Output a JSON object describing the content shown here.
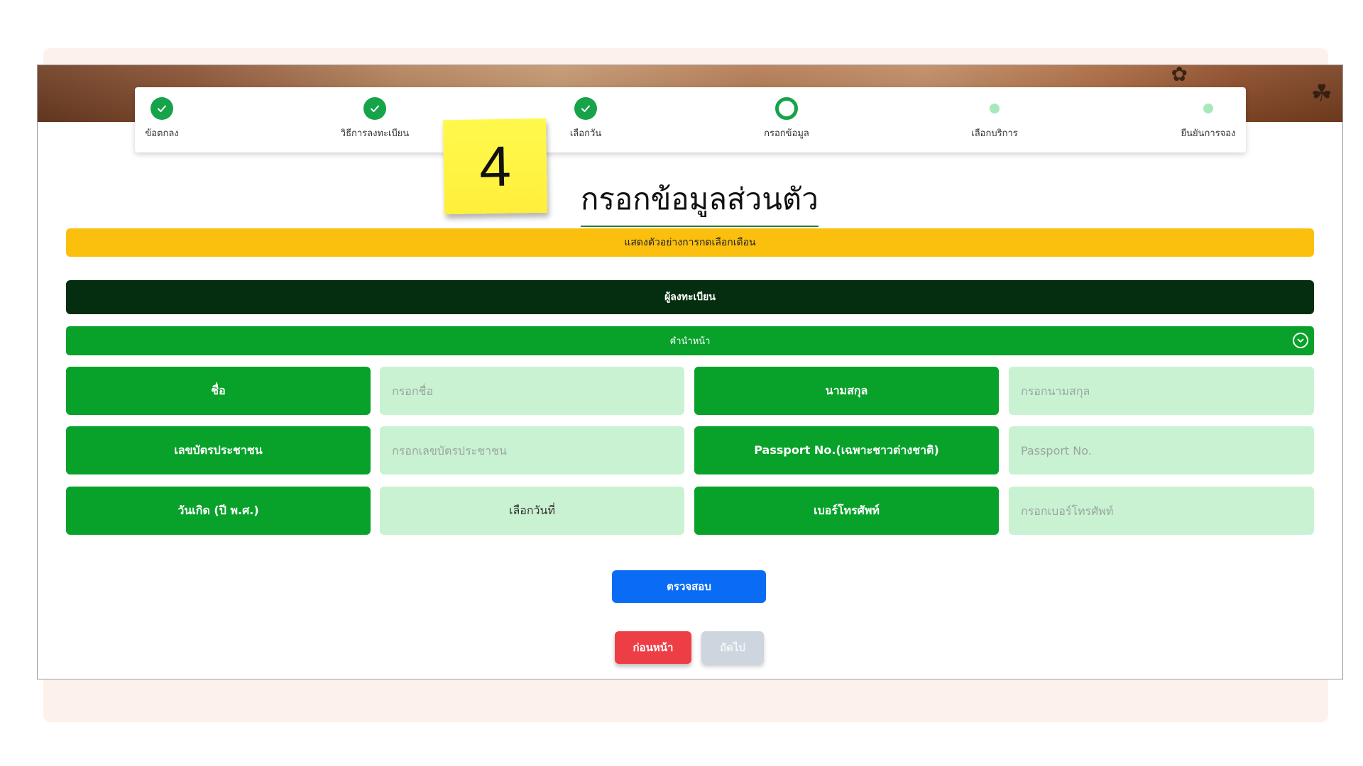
{
  "stepper": {
    "steps": [
      {
        "label": "ข้อตกลง",
        "state": "done"
      },
      {
        "label": "วิธีการลงทะเบียน",
        "state": "done"
      },
      {
        "label": "เลือกวัน",
        "state": "done"
      },
      {
        "label": "กรอกข้อมูล",
        "state": "current"
      },
      {
        "label": "เลือกบริการ",
        "state": "pending"
      },
      {
        "label": "ยืนยันการจอง",
        "state": "pending"
      }
    ]
  },
  "sticky_note": {
    "number": "4"
  },
  "page_title": "กรอกข้อมูลส่วนตัว",
  "alert_text": "แสดงตัวอย่างการกดเลือกเดือน",
  "section_header": "ผู้ลงทะเบียน",
  "title_select": {
    "label": "คำนำหน้า",
    "icon": "chevron-down-circle-icon"
  },
  "form": {
    "first_name": {
      "label": "ชื่อ",
      "placeholder": "กรอกชื่อ"
    },
    "last_name": {
      "label": "นามสกุล",
      "placeholder": "กรอกนามสกุล"
    },
    "id_card": {
      "label": "เลขบัตรประชาชน",
      "placeholder": "กรอกเลขบัตรประชาชน"
    },
    "passport": {
      "label": "Passport No.(เฉพาะชาวต่างชาติ)",
      "placeholder": "Passport No."
    },
    "birth_date": {
      "label": "วันเกิด (ปี พ.ศ.)",
      "value": "เลือกวันที่"
    },
    "phone": {
      "label": "เบอร์โทรศัพท์",
      "placeholder": "กรอกเบอร์โทรศัพท์"
    }
  },
  "buttons": {
    "check": "ตรวจสอบ",
    "prev": "ก่อนหน้า",
    "next": "ถัดไป"
  },
  "colors": {
    "primary_green": "#08a22a",
    "input_bg": "#c9f2d2",
    "alert": "#fbbf0e",
    "header_dark": "#052e10",
    "blue": "#0a6cf5",
    "red": "#ee3e45"
  }
}
